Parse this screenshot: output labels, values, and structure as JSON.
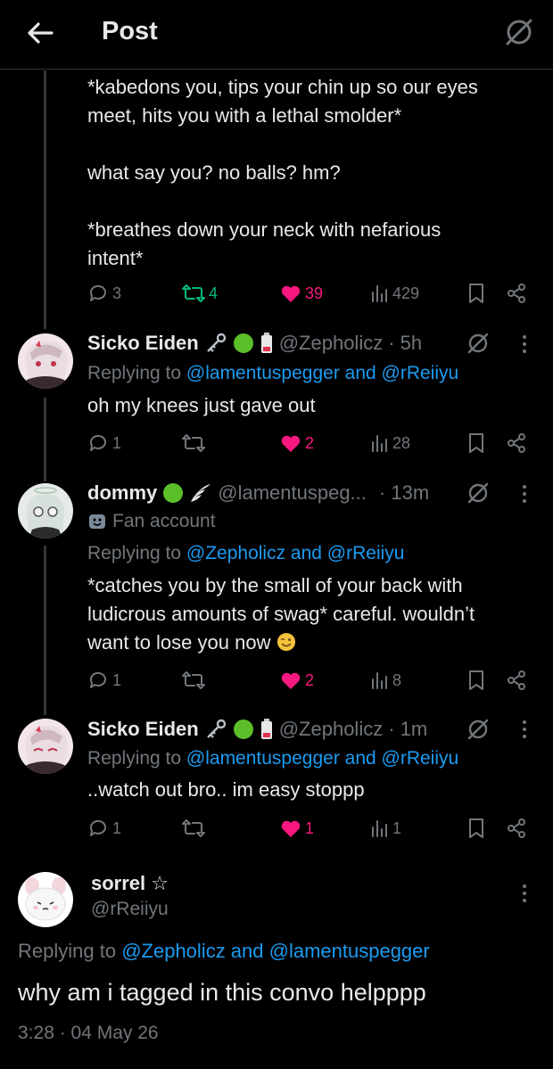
{
  "header": {
    "title": "Post"
  },
  "first_post": {
    "text": "*kabedons you, tips your chin up so our eyes\nmeet, hits you with a lethal smolder*\n\nwhat say you? no balls? hm?\n\n*breathes down your neck with nefarious\nintent*",
    "replies": "3",
    "reposts": "4",
    "likes": "39",
    "views": "429"
  },
  "reply1": {
    "name": "Sicko Eiden",
    "handle": "@Zepholicz",
    "time": "· 5h",
    "replying_prefix": "Replying to",
    "replying_to": "@lamentuspegger and @rReiiyu",
    "text": "oh my knees just gave out",
    "replies": "1",
    "reposts": "",
    "likes": "2",
    "views": "28"
  },
  "reply2": {
    "name": "dommy",
    "handle": "@lamentuspeg...",
    "time": "· 13m",
    "label": "Fan account",
    "replying_prefix": "Replying to",
    "replying_to": "@Zepholicz and @rReiiyu",
    "text": "*catches you by the small of your back with\nludicrous amounts of swag* careful. wouldn’t\nwant to lose you now",
    "replies": "1",
    "reposts": "",
    "likes": "2",
    "views": "8"
  },
  "reply3": {
    "name": "Sicko Eiden",
    "handle": "@Zepholicz",
    "time": "· 1m",
    "replying_prefix": "Replying to",
    "replying_to": "@lamentuspegger and @rReiiyu",
    "text": "..watch out bro.. im easy stoppp",
    "replies": "1",
    "reposts": "",
    "likes": "1",
    "views": "1"
  },
  "main_post": {
    "name": "sorrel ☆",
    "handle": "@rReiiyu",
    "replying_prefix": "Replying to",
    "replying_to": "@Zepholicz and @lamentuspegger",
    "text": "why am i tagged in this convo helpppp",
    "timestamp": "3:28 · 04 May 26"
  },
  "colors": {
    "background": "#000000",
    "text": "#e7e9ea",
    "muted": "#71767b",
    "link": "#1d9bf0",
    "like": "#f91880",
    "repost": "#00ba7c"
  }
}
